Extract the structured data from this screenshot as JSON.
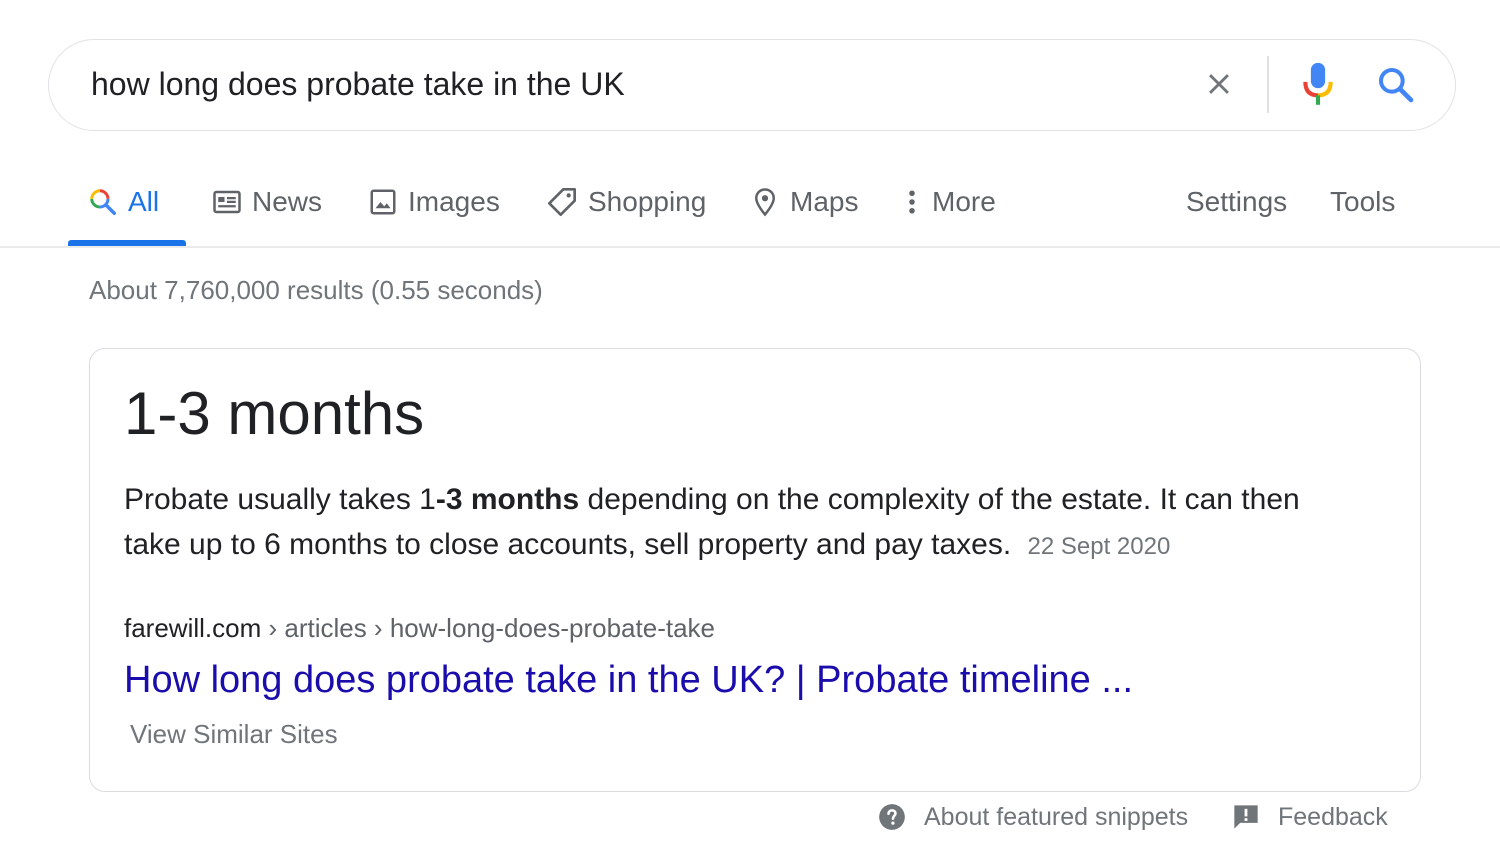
{
  "search": {
    "query": "how long does probate take in the UK",
    "icons": {
      "clear": "close-icon",
      "voice": "mic-icon",
      "submit": "search-icon"
    }
  },
  "tabs": [
    {
      "label": "All",
      "icon": "search-icon",
      "active": true
    },
    {
      "label": "News",
      "icon": "news-icon"
    },
    {
      "label": "Images",
      "icon": "image-icon"
    },
    {
      "label": "Shopping",
      "icon": "tag-icon"
    },
    {
      "label": "Maps",
      "icon": "map-pin-icon"
    },
    {
      "label": "More",
      "icon": "more-vertical-icon"
    }
  ],
  "tools": {
    "settings": "Settings",
    "tools": "Tools"
  },
  "result_stats": "About 7,760,000 results (0.55 seconds)",
  "snippet": {
    "answer": "1-3 months",
    "desc_prefix": "Probate usually takes 1",
    "desc_bold": "-3 months",
    "desc_suffix": " depending on the complexity of the estate. It can then take up to 6 months to close accounts, sell property and pay taxes.",
    "date": "22 Sept 2020",
    "site": "farewill.com",
    "breadcrumb": " › articles › how-long-does-probate-take",
    "title": "How long does probate take in the UK? | Probate timeline ...",
    "similar": "View Similar Sites"
  },
  "footer": {
    "about": "About featured snippets",
    "feedback": "Feedback"
  },
  "colors": {
    "accent": "#1a73e8",
    "link": "#1a0dab",
    "muted": "#70757a"
  }
}
